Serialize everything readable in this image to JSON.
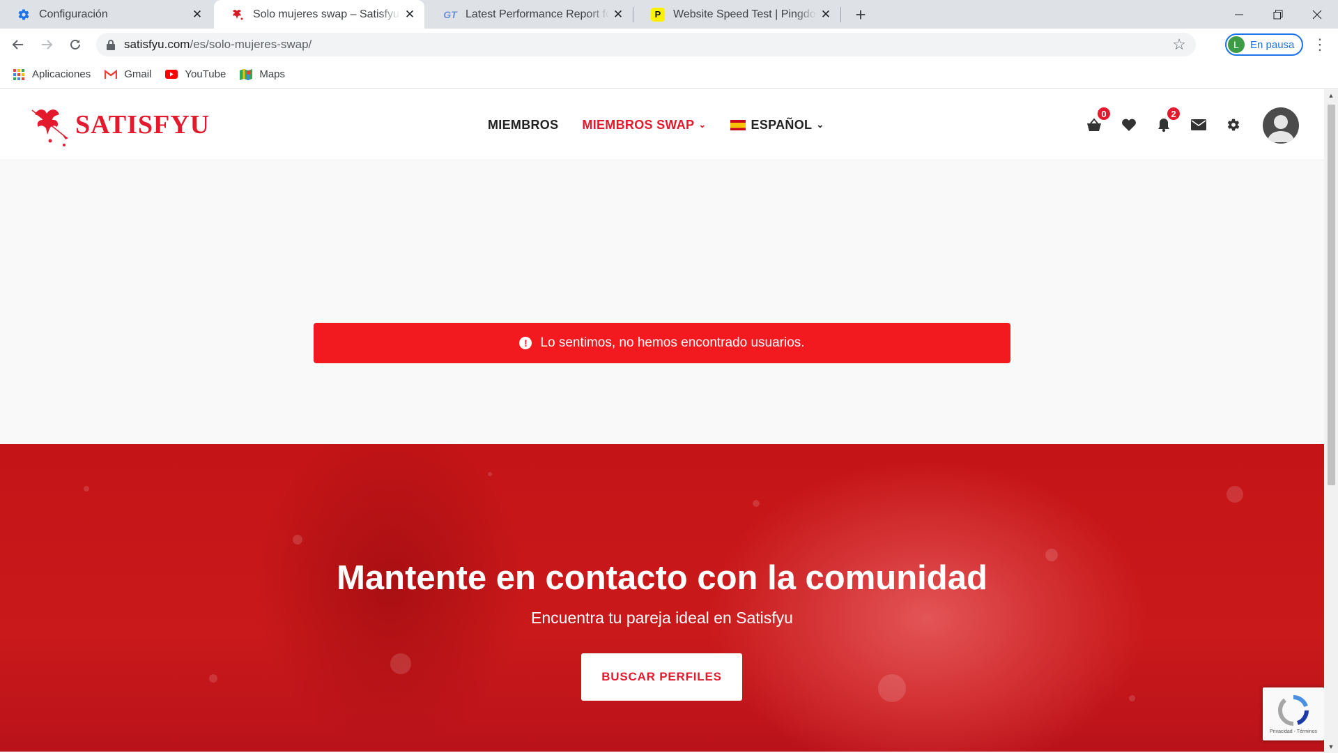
{
  "tabs": [
    {
      "title": "Configuración",
      "icon": "gear-icon"
    },
    {
      "title": "Solo mujeres swap – Satisfyu",
      "icon": "cupid-icon",
      "active": true
    },
    {
      "title": "Latest Performance Report for: ht",
      "icon": "gtmetrix-icon",
      "icon_text": "GT"
    },
    {
      "title": "Website Speed Test | Pingdom To",
      "icon": "pingdom-icon",
      "icon_text": "P"
    }
  ],
  "address_bar": {
    "domain": "satisfyu.com",
    "path": "/es/solo-mujeres-swap/"
  },
  "profile": {
    "initial": "L",
    "label": "En pausa"
  },
  "bookmarks": [
    {
      "label": "Aplicaciones",
      "icon": "apps-grid-icon"
    },
    {
      "label": "Gmail",
      "icon": "gmail-icon"
    },
    {
      "label": "YouTube",
      "icon": "youtube-icon"
    },
    {
      "label": "Maps",
      "icon": "maps-icon"
    }
  ],
  "site": {
    "logo_text": "SATISFYU",
    "nav": {
      "members": "MIEMBROS",
      "members_swap": "MIEMBROS SWAP",
      "language": "ESPAÑOL"
    },
    "badges": {
      "cart": "0",
      "notifications": "2"
    },
    "alert": "Lo sentimos, no hemos encontrado usuarios.",
    "hero": {
      "title": "Mantente en contacto con la comunidad",
      "subtitle": "Encuentra tu pareja ideal en Satisfyu",
      "button": "BUSCAR PERFILES"
    },
    "recaptcha_text": "Privacidad - Términos"
  },
  "colors": {
    "brand_red": "#e3192d",
    "alert_red": "#f21a1e",
    "hero_red": "#c9191b"
  }
}
